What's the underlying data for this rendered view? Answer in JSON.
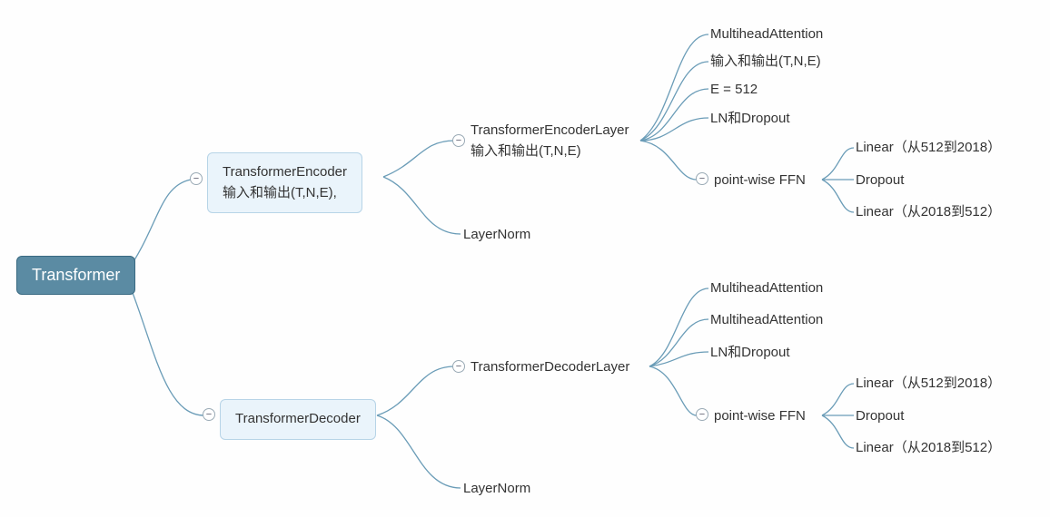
{
  "root": {
    "label": "Transformer"
  },
  "encoder": {
    "label_line1": "TransformerEncoder",
    "label_line2": "输入和输出(T,N,E),",
    "children": {
      "encoderLayer": {
        "label_line1": "TransformerEncoderLayer",
        "label_line2": "输入和输出(T,N,E)",
        "children": {
          "mha": "MultiheadAttention",
          "io": "输入和输出(T,N,E)",
          "e512": "E = 512",
          "lnDropout": "LN和Dropout",
          "ffn": {
            "label": "point-wise FFN",
            "children": {
              "linear1": "Linear（从512到2018）",
              "dropout": "Dropout",
              "linear2": "Linear（从2018到512）"
            }
          }
        }
      },
      "layerNorm": "LayerNorm"
    }
  },
  "decoder": {
    "label": "TransformerDecoder",
    "children": {
      "decoderLayer": {
        "label": "TransformerDecoderLayer",
        "children": {
          "mha1": "MultiheadAttention",
          "mha2": "MultiheadAttention",
          "lnDropout": "LN和Dropout",
          "ffn": {
            "label": "point-wise FFN",
            "children": {
              "linear1": "Linear（从512到2018）",
              "dropout": "Dropout",
              "linear2": "Linear（从2018到512）"
            }
          }
        }
      },
      "layerNorm": "LayerNorm"
    }
  },
  "colors": {
    "rootBg": "#5b8ba3",
    "boxedBg": "#eaf4fb",
    "stroke": "#6a9cb7"
  }
}
